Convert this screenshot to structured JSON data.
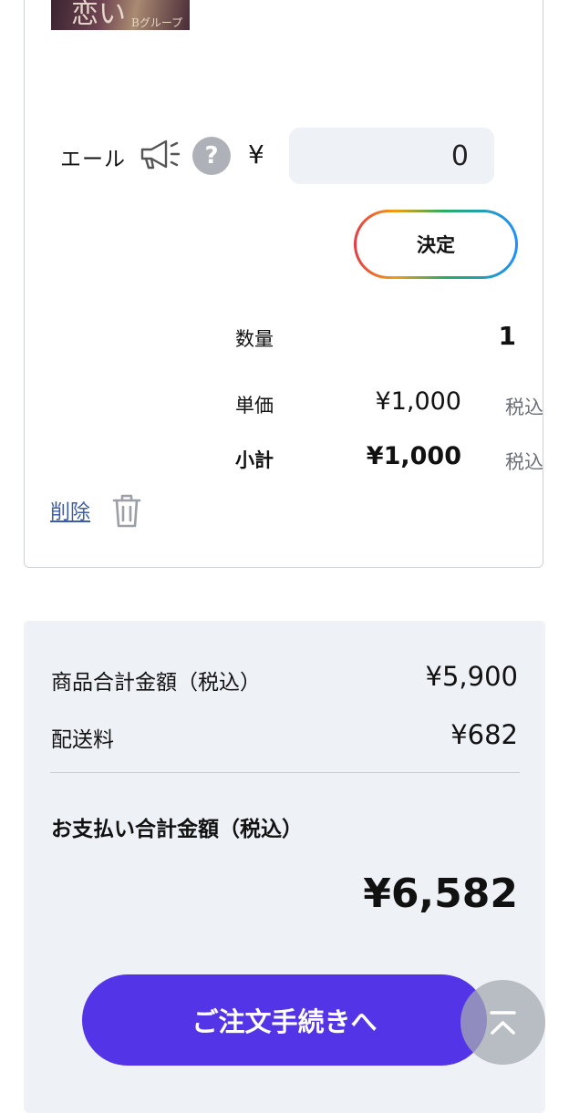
{
  "product": {
    "thumbnail_text": "恋い",
    "thumbnail_sub": "Bグループ"
  },
  "ale": {
    "label": "エール",
    "currency_symbol": "¥",
    "input_value": "0",
    "help_icon": "?",
    "decide_label": "決定"
  },
  "line_item": {
    "qty_label": "数量",
    "qty_value": "1",
    "unit_price_label": "単価",
    "unit_price_value": "¥1,000",
    "subtotal_label": "小計",
    "subtotal_value": "¥1,000",
    "tax_label": "税込",
    "delete_label": "削除"
  },
  "summary": {
    "items_total_label": "商品合計金額（税込）",
    "items_total_value": "¥5,900",
    "shipping_label": "配送料",
    "shipping_value": "¥682",
    "payment_total_label": "お支払い合計金額（税込）",
    "payment_total_value": "¥6,582"
  },
  "checkout": {
    "button_label": "ご注文手続きへ"
  },
  "icons": [
    "megaphone-icon",
    "help-icon",
    "trash-icon",
    "scroll-to-top-icon"
  ],
  "colors": {
    "checkout_button": "#5334e6",
    "link": "#3d5ea6",
    "summary_bg": "#eef1f5"
  }
}
